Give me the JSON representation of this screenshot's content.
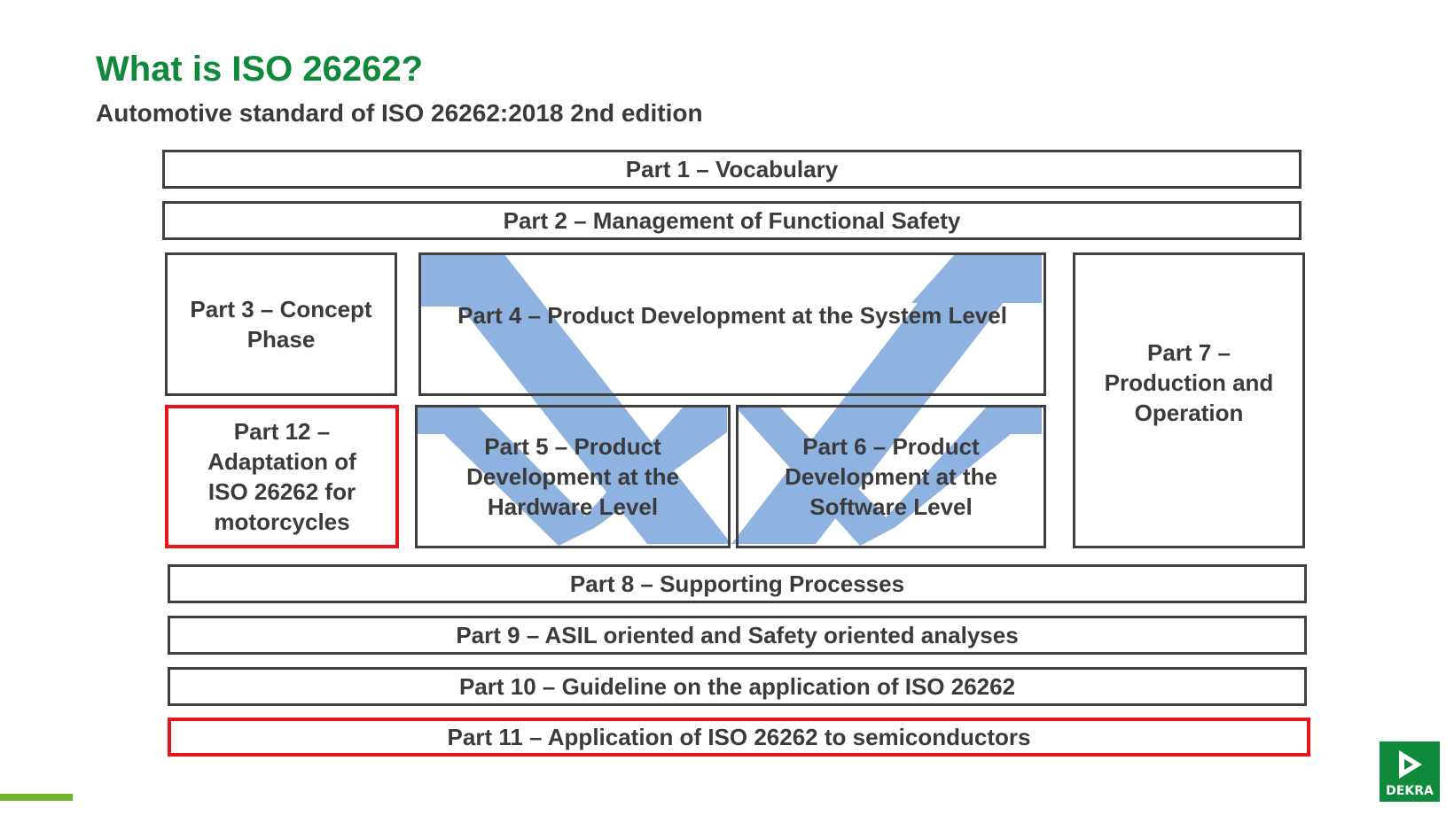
{
  "header": {
    "title": "What is ISO 26262?",
    "subtitle": "Automotive standard of ISO 26262:2018 2nd edition"
  },
  "parts": {
    "p1": "Part 1 – Vocabulary",
    "p2": "Part 2 – Management of Functional Safety",
    "p3": "Part 3 – Concept Phase",
    "p4": "Part 4 – Product Development at the System Level",
    "p5": "Part 5 – Product Development at the Hardware Level",
    "p6": "Part 6 – Product Development at the Software Level",
    "p7": "Part 7 – Production and Operation",
    "p8": "Part 8 – Supporting Processes",
    "p9": "Part 9 – ASIL oriented and Safety oriented analyses",
    "p10": "Part 10 – Guideline on the application of ISO 26262",
    "p11": "Part 11 – Application of ISO 26262 to semiconductors",
    "p12": "Part 12 – Adaptation of ISO 26262 for motorcycles"
  },
  "highlighted": [
    "p11",
    "p12"
  ],
  "colors": {
    "title": "#0f8a3a",
    "box_border": "#3f3f3f",
    "highlight_border": "#e8141b",
    "v_shape": "#8fb3e0",
    "logo_bg": "#0f8a3a",
    "accent_line": "#6fb32e"
  },
  "logo": {
    "text": "DEKRA",
    "icon": "dekra-triangle-icon"
  }
}
